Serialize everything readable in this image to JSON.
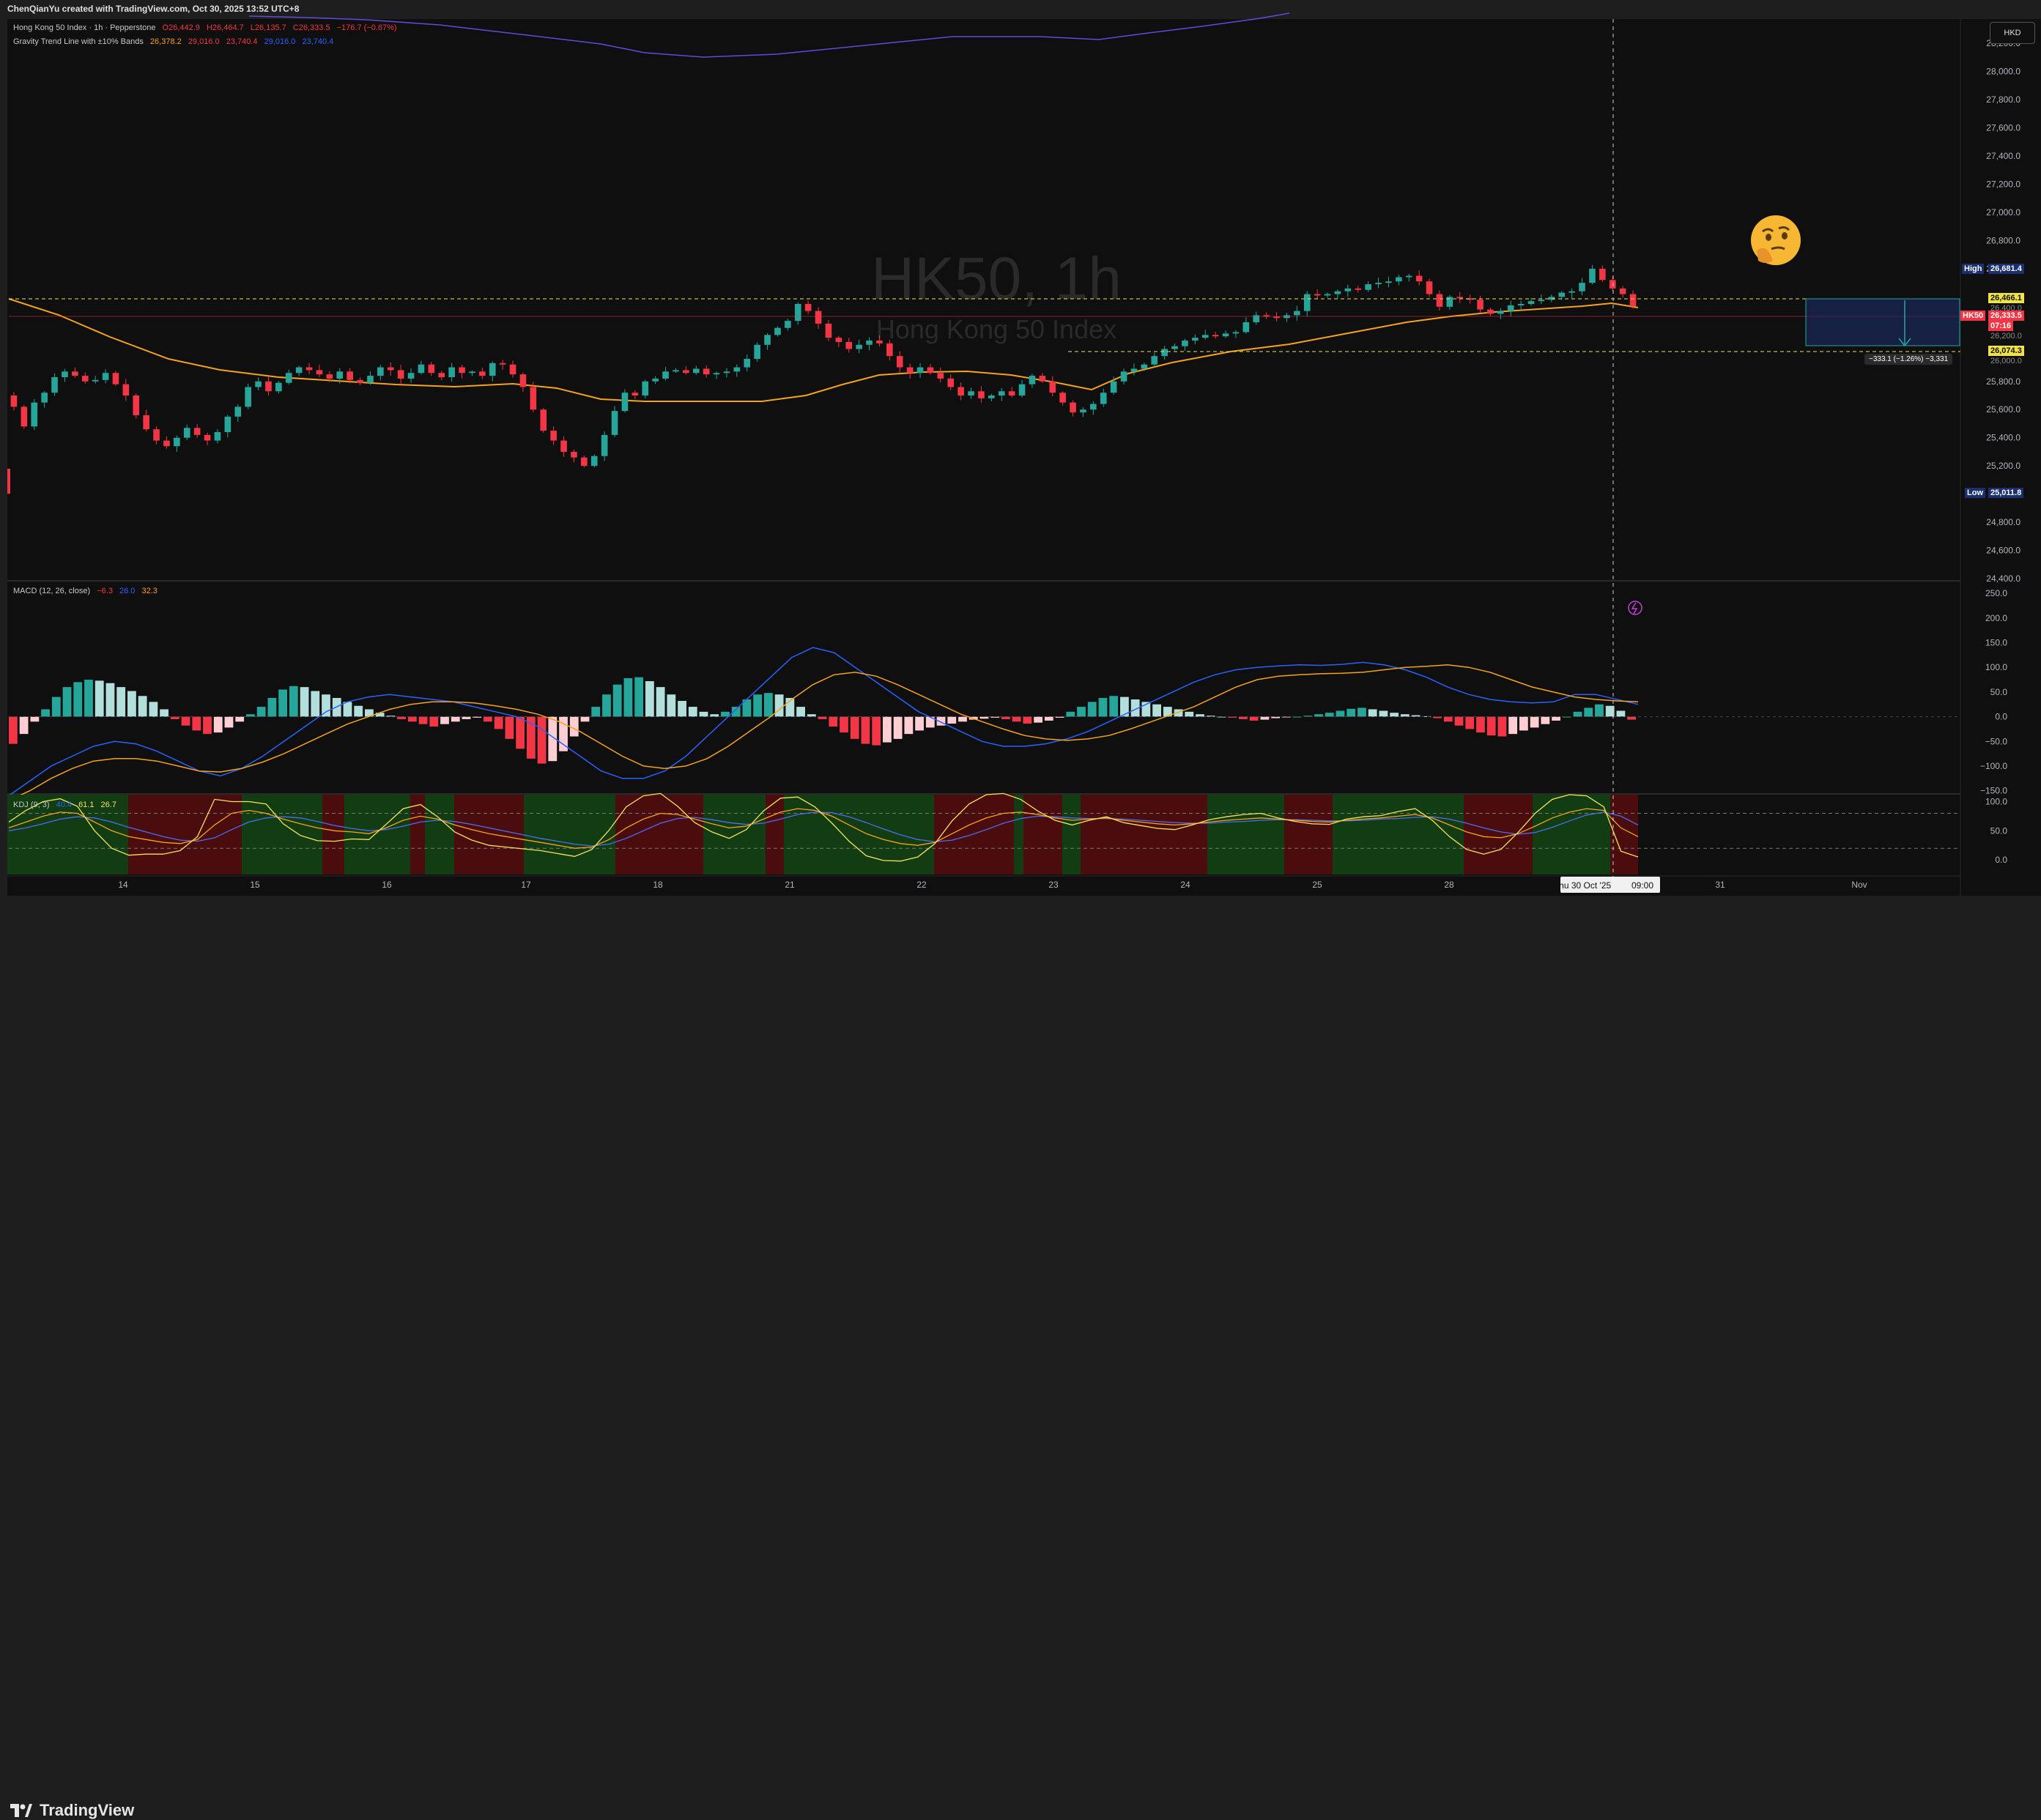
{
  "credit": "ChenQianYu created with TradingView.com, Oct 30, 2025 13:52 UTC+8",
  "currency": "HKD",
  "logo": "TradingView",
  "watermark": {
    "symbol": "HK50, 1h",
    "name": "Hong Kong 50 Index"
  },
  "legend_main": {
    "title": "Hong Kong 50 Index · 1h · Pepperstone",
    "o": "O26,442.9",
    "h": "H26,464.7",
    "l": "L26,135.7",
    "c": "C26,333.5",
    "chg": "−176.7 (−0.67%)"
  },
  "legend_gravity": {
    "title": "Gravity Trend Line with ±10% Bands",
    "v1": "26,378.2",
    "v2": "29,016.0",
    "v3": "23,740.4",
    "v4": "29,016.0",
    "v5": "23,740.4"
  },
  "legend_macd": {
    "title": "MACD (12, 26, close)",
    "v1": "−6.3",
    "v2": "26.0",
    "v3": "32.3"
  },
  "legend_kdj": {
    "title": "KDJ (9, 3)",
    "v1": "40.4",
    "v2": "61.1",
    "v3": "26.7"
  },
  "colors": {
    "up": "#26a69a",
    "down": "#f23645",
    "gravity": "#f7a21b",
    "macd": "#2962ff",
    "signal": "#f7a21b",
    "kdj_k": "#f7e35c",
    "kdj_d": "#4a6cf7",
    "kdj_j": "#f7a21b",
    "bg_green": "#123d12",
    "bg_red": "#4a0c0c"
  },
  "tags": {
    "high_label": "High",
    "high_value": "26,681.4",
    "low_label": "Low",
    "low_value": "25,011.8",
    "upper_line": "26,466.1",
    "lower_line": "26,074.3",
    "symbol_tag": "HK50",
    "last_price": "26,333.5",
    "countdown": "07:16",
    "hidden1": "26,400.0",
    "hidden2": "26,200.0",
    "hidden3": "26,000.0",
    "measure": "−333.1 (−1.26%) −3,331"
  },
  "price_axis": [
    "28,200.0",
    "28,000.0",
    "27,800.0",
    "27,600.0",
    "27,400.0",
    "27,200.0",
    "27,000.0",
    "26,800.0",
    "26,600.0",
    "25,800.0",
    "25,600.0",
    "25,400.0",
    "25,200.0",
    "24,800.0",
    "24,600.0",
    "24,400.0"
  ],
  "macd_axis": [
    "250.0",
    "200.0",
    "150.0",
    "100.0",
    "50.0",
    "0.0",
    "−50.0",
    "−100.0",
    "−150.0"
  ],
  "kdj_axis": [
    "100.0",
    "50.0",
    "0.0"
  ],
  "time_axis": [
    "14",
    "15",
    "16",
    "17",
    "18",
    "21",
    "22",
    "23",
    "24",
    "25",
    "28",
    "31",
    "Nov"
  ],
  "crosshair_time": "Thu 30 Oct '25",
  "crosshair_hour": "09:00",
  "chart_data": [
    {
      "type": "candlestick",
      "title": "HK50, 1h",
      "subtitle": "Hong Kong 50 Index",
      "x_labels": [
        "14",
        "15",
        "16",
        "17",
        "18",
        "21",
        "22",
        "23",
        "24",
        "25",
        "28",
        "31",
        "Nov"
      ],
      "ylim": [
        24400,
        28300
      ],
      "close": [
        25620,
        25480,
        25650,
        25720,
        25830,
        25870,
        25840,
        25800,
        25810,
        25860,
        25780,
        25700,
        25560,
        25460,
        25380,
        25340,
        25400,
        25470,
        25420,
        25380,
        25440,
        25550,
        25620,
        25760,
        25800,
        25730,
        25790,
        25860,
        25900,
        25880,
        25850,
        25820,
        25870,
        25810,
        25790,
        25840,
        25900,
        25880,
        25820,
        25860,
        25920,
        25860,
        25830,
        25900,
        25860,
        25870,
        25840,
        25930,
        25920,
        25850,
        25760,
        25600,
        25450,
        25380,
        25300,
        25260,
        25200,
        25270,
        25420,
        25590,
        25720,
        25700,
        25800,
        25820,
        25870,
        25880,
        25860,
        25890,
        25850,
        25860,
        25870,
        25900,
        25960,
        26060,
        26130,
        26180,
        26230,
        26350,
        26300,
        26210,
        26110,
        26080,
        26030,
        26060,
        26090,
        26070,
        25980,
        25900,
        25860,
        25900,
        25860,
        25820,
        25760,
        25700,
        25730,
        25680,
        25700,
        25730,
        25700,
        25780,
        25840,
        25800,
        25720,
        25650,
        25580,
        25600,
        25640,
        25720,
        25800,
        25870,
        25890,
        25920,
        25980,
        26030,
        26050,
        26090,
        26110,
        26130,
        26120,
        26140,
        26150,
        26220,
        26270,
        26260,
        26250,
        26270,
        26300,
        26420,
        26410,
        26420,
        26440,
        26460,
        26450,
        26490,
        26500,
        26510,
        26540,
        26550,
        26510,
        26420,
        26330,
        26400,
        26390,
        26380,
        26310,
        26280,
        26300,
        26340,
        26350,
        26370,
        26380,
        26400,
        26430,
        26440,
        26500,
        26600,
        26520,
        26460,
        26420,
        26333
      ],
      "macd_hist_range": [
        -150,
        250
      ],
      "macd_hist": [
        -55,
        -35,
        -10,
        15,
        40,
        60,
        70,
        75,
        73,
        68,
        60,
        52,
        42,
        30,
        15,
        -5,
        -18,
        -28,
        -35,
        -32,
        -22,
        -10,
        5,
        20,
        38,
        55,
        62,
        60,
        52,
        45,
        38,
        30,
        22,
        15,
        8,
        2,
        -5,
        -10,
        -15,
        -20,
        -15,
        -10,
        -5,
        -2,
        -10,
        -25,
        -45,
        -65,
        -85,
        -95,
        -90,
        -70,
        -40,
        -10,
        20,
        45,
        65,
        78,
        80,
        72,
        60,
        45,
        32,
        20,
        10,
        5,
        10,
        20,
        35,
        45,
        48,
        45,
        38,
        20,
        5,
        -5,
        -20,
        -32,
        -45,
        -55,
        -58,
        -52,
        -45,
        -35,
        -28,
        -22,
        -18,
        -14,
        -10,
        -6,
        -4,
        -2,
        -5,
        -10,
        -14,
        -12,
        -8,
        -2,
        10,
        20,
        30,
        38,
        42,
        40,
        35,
        30,
        25,
        20,
        15,
        10,
        5,
        2,
        0,
        -2,
        -5,
        -8,
        -6,
        -3,
        -1,
        0,
        2,
        5,
        8,
        12,
        16,
        18,
        15,
        12,
        8,
        5,
        3,
        1,
        -3,
        -10,
        -18,
        -25,
        -32,
        -38,
        -40,
        -35,
        -28,
        -22,
        -15,
        -8,
        0,
        10,
        18,
        25,
        22,
        12,
        -6
      ],
      "macd_line": [
        -160,
        -130,
        -100,
        -80,
        -60,
        -50,
        -55,
        -70,
        -90,
        -110,
        -120,
        -105,
        -80,
        -50,
        -20,
        10,
        30,
        40,
        45,
        40,
        35,
        30,
        20,
        10,
        0,
        -20,
        -50,
        -80,
        -110,
        -125,
        -125,
        -110,
        -80,
        -40,
        0,
        40,
        80,
        120,
        140,
        130,
        100,
        70,
        40,
        10,
        -10,
        -30,
        -50,
        -60,
        -60,
        -55,
        -45,
        -30,
        -10,
        10,
        30,
        50,
        70,
        85,
        95,
        100,
        103,
        105,
        104,
        106,
        110,
        105,
        95,
        80,
        60,
        45,
        35,
        30,
        28,
        30,
        45,
        45,
        35,
        25
      ],
      "signal_line": [
        -170,
        -150,
        -125,
        -105,
        -90,
        -85,
        -85,
        -90,
        -100,
        -110,
        -112,
        -105,
        -92,
        -75,
        -55,
        -35,
        -15,
        0,
        15,
        25,
        30,
        30,
        28,
        22,
        15,
        5,
        -10,
        -30,
        -55,
        -80,
        -100,
        -105,
        -100,
        -85,
        -60,
        -30,
        0,
        35,
        65,
        85,
        90,
        82,
        65,
        45,
        25,
        5,
        -10,
        -25,
        -38,
        -45,
        -48,
        -45,
        -38,
        -25,
        -10,
        5,
        20,
        40,
        60,
        75,
        82,
        85,
        87,
        88,
        90,
        95,
        100,
        102,
        105,
        100,
        90,
        75,
        60,
        50,
        40,
        35,
        32,
        30
      ],
      "kdj": {
        "k": [
          55,
          65,
          75,
          82,
          80,
          65,
          50,
          40,
          35,
          30,
          28,
          35,
          60,
          80,
          85,
          80,
          70,
          62,
          55,
          50,
          48,
          45,
          55,
          68,
          75,
          70,
          60,
          52,
          45,
          40,
          35,
          30,
          25,
          20,
          22,
          35,
          55,
          70,
          80,
          78,
          70,
          62,
          55,
          58,
          70,
          82,
          88,
          85,
          75,
          60,
          45,
          35,
          28,
          25,
          30,
          45,
          60,
          72,
          80,
          82,
          78,
          72,
          68,
          70,
          72,
          68,
          65,
          62,
          60,
          62,
          65,
          68,
          70,
          72,
          70,
          68,
          66,
          65,
          68,
          70,
          72,
          75,
          78,
          72,
          60,
          48,
          40,
          38,
          45,
          58,
          72,
          82,
          88,
          85,
          55,
          40
        ],
        "d": [
          50,
          55,
          62,
          70,
          74,
          72,
          65,
          56,
          48,
          40,
          34,
          32,
          38,
          52,
          65,
          72,
          74,
          72,
          66,
          59,
          54,
          50,
          52,
          58,
          65,
          68,
          66,
          61,
          55,
          49,
          43,
          37,
          32,
          27,
          24,
          27,
          37,
          50,
          63,
          71,
          73,
          69,
          64,
          61,
          63,
          70,
          78,
          82,
          81,
          74,
          64,
          53,
          43,
          35,
          31,
          34,
          42,
          52,
          63,
          71,
          75,
          74,
          72,
          71,
          71,
          70,
          68,
          66,
          64,
          63,
          63,
          65,
          66,
          68,
          69,
          69,
          68,
          67,
          67,
          68,
          70,
          71,
          73,
          74,
          70,
          63,
          55,
          48,
          44,
          47,
          56,
          67,
          77,
          82,
          75,
          60
        ],
        "j": [
          65,
          85,
          100,
          105,
          92,
          50,
          20,
          8,
          10,
          10,
          16,
          40,
          104,
          100,
          100,
          96,
          62,
          42,
          33,
          32,
          36,
          35,
          61,
          88,
          95,
          74,
          48,
          34,
          25,
          22,
          19,
          16,
          11,
          6,
          18,
          51,
          91,
          110,
          114,
          92,
          64,
          48,
          37,
          52,
          84,
          106,
          108,
          91,
          63,
          32,
          7,
          -1,
          -2,
          5,
          28,
          67,
          96,
          112,
          114,
          104,
          84,
          68,
          60,
          68,
          74,
          64,
          59,
          54,
          52,
          60,
          69,
          74,
          78,
          80,
          72,
          66,
          62,
          61,
          70,
          74,
          76,
          83,
          88,
          68,
          40,
          18,
          10,
          18,
          47,
          80,
          104,
          112,
          110,
          91,
          15,
          5
        ],
        "bg_regions": [
          "green",
          "red",
          "green",
          "red",
          "green",
          "red",
          "green",
          "red",
          "green",
          "red",
          "green",
          "red",
          "green",
          "red",
          "green",
          "red",
          "green",
          "red",
          "green",
          "red"
        ]
      }
    }
  ]
}
